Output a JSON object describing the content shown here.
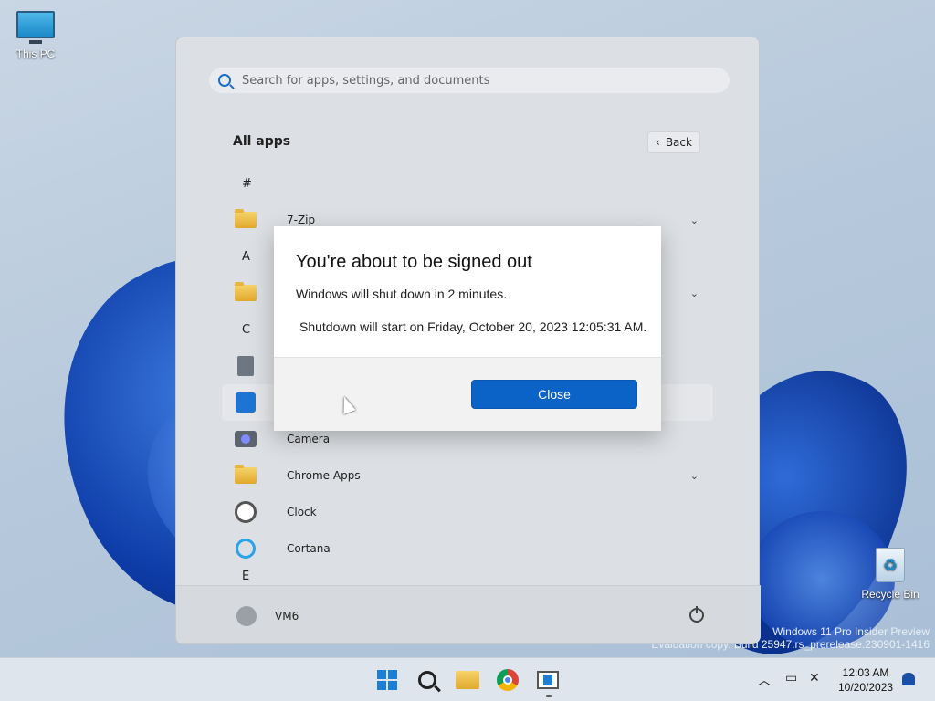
{
  "desktop": {
    "this_pc_label": "This PC",
    "recycle_bin_label": "Recycle Bin",
    "watermark_line1": "Windows 11 Pro Insider Preview",
    "watermark_line2": "Evaluation copy. Build 25947.rs_prerelease.230901-1416"
  },
  "start_menu": {
    "search_placeholder": "Search for apps, settings, and documents",
    "all_apps_title": "All apps",
    "back_label": "Back",
    "sections": [
      {
        "letter": "#"
      },
      {
        "letter": "A"
      },
      {
        "letter": "C"
      },
      {
        "letter": "E"
      }
    ],
    "apps": [
      {
        "name": "7-Zip",
        "icon": "folder-icon",
        "expandable": true
      },
      {
        "name": "",
        "icon": "folder-icon",
        "expandable": true
      },
      {
        "name": "",
        "icon": "calculator-icon",
        "expandable": false
      },
      {
        "name": "",
        "icon": "calendar-icon",
        "expandable": false
      },
      {
        "name": "Camera",
        "icon": "camera-icon",
        "expandable": false
      },
      {
        "name": "Chrome Apps",
        "icon": "folder-icon",
        "expandable": true
      },
      {
        "name": "Clock",
        "icon": "clock-icon",
        "expandable": false
      },
      {
        "name": "Cortana",
        "icon": "cortana-icon",
        "expandable": false
      }
    ],
    "user_name": "VM6"
  },
  "dialog": {
    "title": "You're about to be signed out",
    "message": "Windows will shut down in 2 minutes.",
    "detail": "Shutdown will start on Friday, October 20, 2023 12:05:31 AM.",
    "close_label": "Close"
  },
  "taskbar": {
    "time": "12:03 AM",
    "date": "10/20/2023",
    "accent_color": "#0c63c7"
  }
}
